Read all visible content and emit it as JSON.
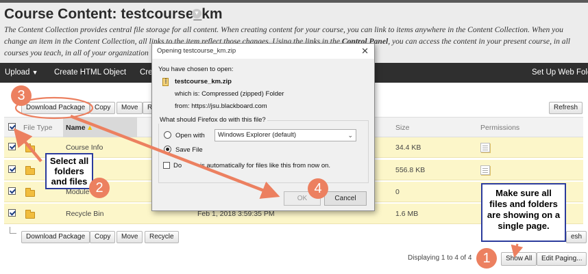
{
  "header": {
    "title": "Course Content: testcourse_km",
    "description_part1": "The Content Collection provides central file storage for all content. When creating content for your course, you can link to items anywhere in the Content Collection. When you change an item in the Content Collection, all links to the item reflect those changes. Using the links in the ",
    "description_bold": "Control Panel",
    "description_part2": ", you can access the content in your present course, in all courses you teach, in all of your organization"
  },
  "actionbar": {
    "upload": "Upload",
    "upload_icon": "chevron-down-icon",
    "create_html": "Create HTML Object",
    "create": "Cre",
    "web_folder": "Set Up Web Folder"
  },
  "toolbar_top": {
    "download": "Download Package",
    "copy": "Copy",
    "move": "Move",
    "recycle_cut": "R",
    "refresh": "Refresh"
  },
  "table": {
    "columns": {
      "file_type": "File Type",
      "name": "Name",
      "size": "Size",
      "permissions": "Permissions"
    },
    "rows": [
      {
        "name": "Course Info",
        "date": "",
        "size": "34.4 KB"
      },
      {
        "name": "",
        "date": "",
        "size": "556.8 KB"
      },
      {
        "name": "Module",
        "date": "",
        "size": "0"
      },
      {
        "name": "Recycle Bin",
        "date": "Feb 1, 2018 3:59:35 PM",
        "size": "1.6 MB"
      }
    ]
  },
  "toolbar_bottom": {
    "download": "Download Package",
    "copy": "Copy",
    "move": "Move",
    "recycle": "Recycle",
    "refresh_cut": "esh"
  },
  "paging": {
    "text": "Displaying 1 to 4 of 4",
    "show_all": "Show All",
    "edit_paging": "Edit Paging..."
  },
  "dialog": {
    "title": "Opening testcourse_km.zip",
    "chosen": "You have chosen to open:",
    "filename": "testcourse_km.zip",
    "which_is": "which is:  Compressed (zipped) Folder",
    "from": "from:  https://jsu.blackboard.com",
    "question": "What should Firefox do with this file?",
    "open_with": "Open with",
    "app": "Windows Explorer (default)",
    "save_file": "Save File",
    "auto_a": "Do",
    "auto_b": "is automatically for files like this from now on.",
    "ok": "OK",
    "cancel": "Cancel"
  },
  "annotations": {
    "select_all": "Select all folders and files",
    "make_sure": "Make sure all files and folders are showing on a single page.",
    "steps": [
      "1",
      "2",
      "3",
      "4"
    ]
  },
  "colors": {
    "arrow": "#ec8060",
    "callout_border": "#2a3a9c",
    "row_highlight": "#fcf6c9"
  }
}
